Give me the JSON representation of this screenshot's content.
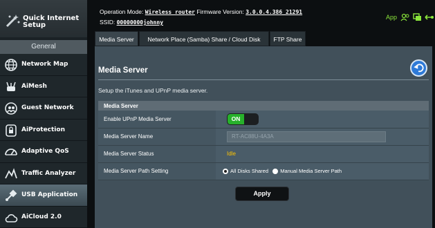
{
  "sidebar": {
    "quick_setup_label": "Quick Internet Setup",
    "section_label": "General",
    "items": [
      {
        "label": "Network Map",
        "icon": "globe-icon"
      },
      {
        "label": "AiMesh",
        "icon": "mesh-router-icon"
      },
      {
        "label": "Guest Network",
        "icon": "guest-network-icon"
      },
      {
        "label": "AiProtection",
        "icon": "lock-shield-icon"
      },
      {
        "label": "Adaptive QoS",
        "icon": "gauge-icon"
      },
      {
        "label": "Traffic Analyzer",
        "icon": "traffic-graph-icon"
      },
      {
        "label": "USB Application",
        "icon": "usb-puzzle-icon",
        "active": true
      },
      {
        "label": "AiCloud 2.0",
        "icon": "cloud-icon"
      }
    ]
  },
  "header": {
    "op_mode_label": "Operation Mode:",
    "op_mode_value": "Wireless router",
    "firmware_label": "Firmware Version:",
    "firmware_value": "3.0.0.4.386_21291",
    "ssid_label": "SSID:",
    "ssid_value": "00000000johnny",
    "app_label": "App",
    "accent_color": "#8be63b"
  },
  "tabs": [
    {
      "label": "Media Server",
      "active": true
    },
    {
      "label": "Network Place (Samba) Share / Cloud Disk"
    },
    {
      "label": "FTP Share"
    }
  ],
  "panel": {
    "title": "Media Server",
    "description": "Setup the iTunes and UPnP media server.",
    "section_header": "Media Server",
    "rows": {
      "enable_label": "Enable UPnP Media Server",
      "enable_value": "ON",
      "name_label": "Media Server Name",
      "name_value": "RT-AC88U-4A3A",
      "status_label": "Media Server Status",
      "status_value": "Idle",
      "path_label": "Media Server Path Setting",
      "path_option_all": "All Disks Shared",
      "path_option_manual": "Manual Media Server Path"
    },
    "apply_label": "Apply"
  }
}
